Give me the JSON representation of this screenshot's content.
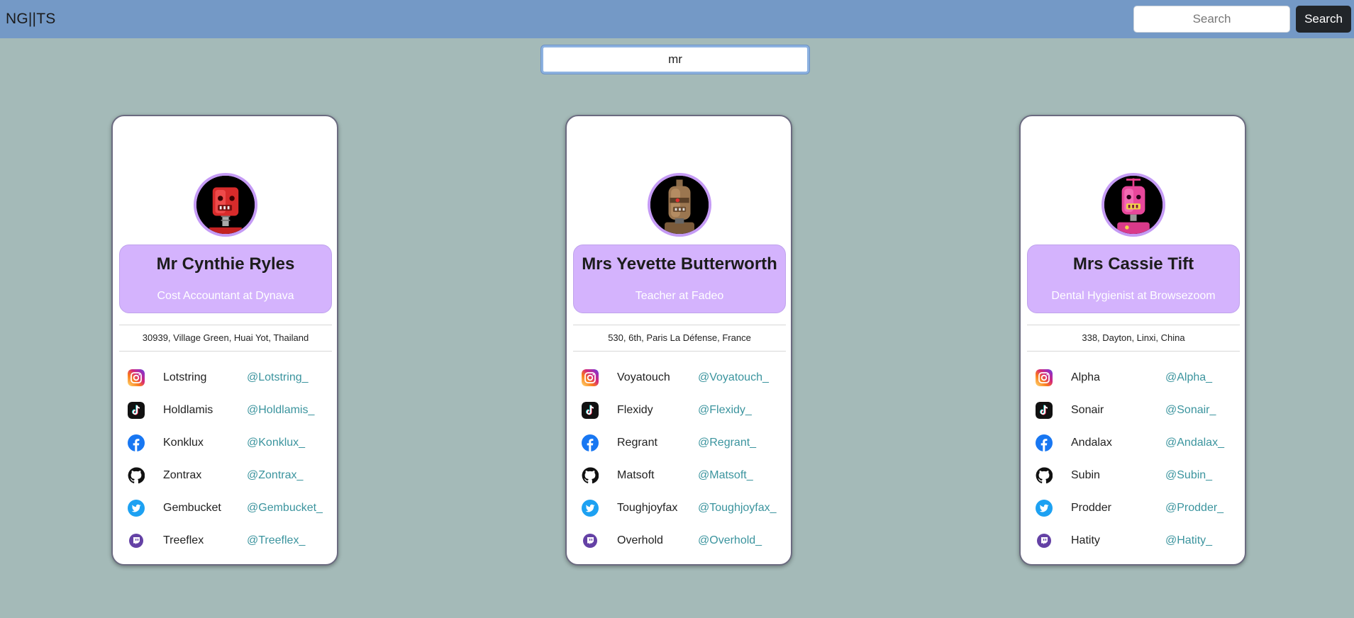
{
  "navbar": {
    "brand": "NG||TS",
    "search_placeholder": "Search",
    "search_button": "Search"
  },
  "filter": {
    "value": "mr"
  },
  "colors": {
    "navbar": "#7499c6",
    "background": "#a4bab8",
    "name_box": "#d4b3fd",
    "avatar_ring": "#c59bf5",
    "handle": "#3b949e"
  },
  "profiles": [
    {
      "name": "Mr Cynthie Ryles",
      "job": "Cost Accountant at Dynava",
      "address": "30939, Village Green, Huai Yot, Thailand",
      "avatar": "red-robot-avatar",
      "socials": [
        {
          "icon": "instagram-icon",
          "name": "Lotstring",
          "handle": "@Lotstring_"
        },
        {
          "icon": "tiktok-icon",
          "name": "Holdlamis",
          "handle": "@Holdlamis_"
        },
        {
          "icon": "facebook-icon",
          "name": "Konklux",
          "handle": "@Konklux_"
        },
        {
          "icon": "github-icon",
          "name": "Zontrax",
          "handle": "@Zontrax_"
        },
        {
          "icon": "twitter-icon",
          "name": "Gembucket",
          "handle": "@Gembucket_"
        },
        {
          "icon": "twitch-icon",
          "name": "Treeflex",
          "handle": "@Treeflex_"
        }
      ]
    },
    {
      "name": "Mrs Yevette Butterworth",
      "job": "Teacher at Fadeo",
      "address": "530, 6th, Paris La Défense, France",
      "avatar": "brown-robot-avatar",
      "socials": [
        {
          "icon": "instagram-icon",
          "name": "Voyatouch",
          "handle": "@Voyatouch_"
        },
        {
          "icon": "tiktok-icon",
          "name": "Flexidy",
          "handle": "@Flexidy_"
        },
        {
          "icon": "facebook-icon",
          "name": "Regrant",
          "handle": "@Regrant_"
        },
        {
          "icon": "github-icon",
          "name": "Matsoft",
          "handle": "@Matsoft_"
        },
        {
          "icon": "twitter-icon",
          "name": "Toughjoyfax",
          "handle": "@Toughjoyfax_"
        },
        {
          "icon": "twitch-icon",
          "name": "Overhold",
          "handle": "@Overhold_"
        }
      ]
    },
    {
      "name": "Mrs Cassie Tift",
      "job": "Dental Hygienist at Browsezoom",
      "address": "338, Dayton, Linxi, China",
      "avatar": "pink-robot-avatar",
      "socials": [
        {
          "icon": "instagram-icon",
          "name": "Alpha",
          "handle": "@Alpha_"
        },
        {
          "icon": "tiktok-icon",
          "name": "Sonair",
          "handle": "@Sonair_"
        },
        {
          "icon": "facebook-icon",
          "name": "Andalax",
          "handle": "@Andalax_"
        },
        {
          "icon": "github-icon",
          "name": "Subin",
          "handle": "@Subin_"
        },
        {
          "icon": "twitter-icon",
          "name": "Prodder",
          "handle": "@Prodder_"
        },
        {
          "icon": "twitch-icon",
          "name": "Hatity",
          "handle": "@Hatity_"
        }
      ]
    }
  ]
}
